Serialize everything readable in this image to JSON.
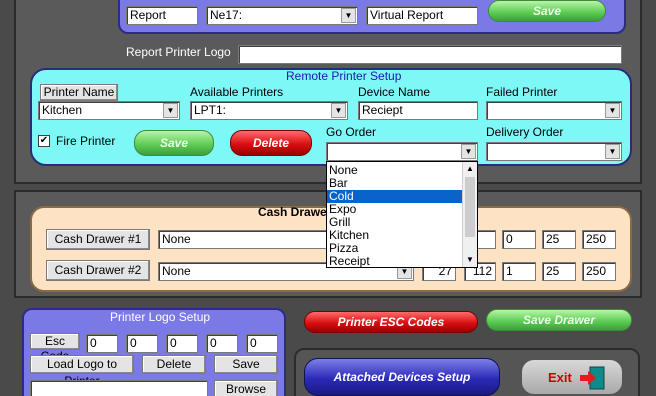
{
  "top": {
    "report_field": "Report",
    "printer_combo": "Ne17:",
    "virtual_report": "Virtual Report",
    "save_label": "Save",
    "logo_label": "Report Printer Logo",
    "logo_value": ""
  },
  "remote": {
    "title": "Remote Printer Setup",
    "printer_name_label": "Printer Name",
    "printer_name_value": "Kitchen",
    "available_label": "Available Printers",
    "available_value": "LPT1:",
    "device_label": "Device Name",
    "device_value": "Reciept",
    "failed_label": "Failed Printer",
    "failed_value": "",
    "fire_label": "Fire Printer",
    "fire_checked": "✔",
    "save_label": "Save",
    "delete_label": "Delete",
    "go_order_label": "Go Order",
    "go_order_value": "",
    "delivery_label": "Delivery Order",
    "delivery_value": ""
  },
  "dropdown": {
    "items": [
      "None",
      "Bar",
      "Cold",
      "Expo",
      "Grill",
      "Kitchen",
      "Pizza",
      "Receipt"
    ],
    "selected_index": 2
  },
  "drawer": {
    "title": "Cash Drawer",
    "rows": [
      {
        "button": "Cash Drawer #1",
        "printer": "None",
        "c1": "",
        "c2": "2",
        "c3": "0",
        "c4": "25",
        "c5": "250"
      },
      {
        "button": "Cash Drawer #2",
        "printer": "None",
        "c1": "27",
        "c2": "112",
        "c3": "1",
        "c4": "25",
        "c5": "250"
      }
    ]
  },
  "logo": {
    "title": "Printer Logo Setup",
    "esc_label": "Esc Code",
    "codes": [
      "0",
      "0",
      "0",
      "0",
      "0"
    ],
    "load_label": "Load Logo to Printer",
    "delete_label": "Delete",
    "save_label": "Save",
    "path_value": "",
    "browse_label": "Browse"
  },
  "actions": {
    "esc_codes_label": "Printer ESC Codes",
    "save_drawer_label": "Save Drawer",
    "attached_label": "Attached Devices Setup",
    "exit_label": "Exit"
  }
}
